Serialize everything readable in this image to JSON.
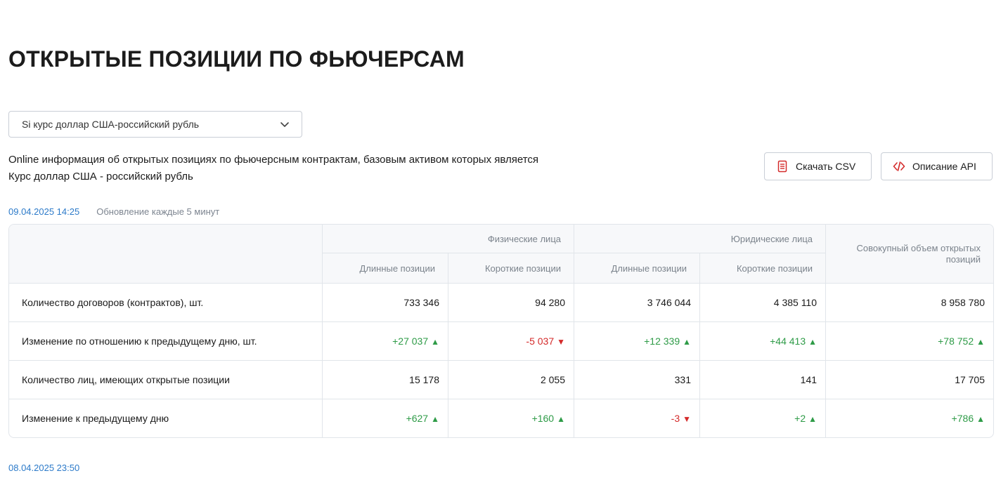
{
  "page": {
    "title": "ОТКРЫТЫЕ ПОЗИЦИИ ПО ФЬЮЧЕРСАМ",
    "selector_value": "Si курс доллар США-российский рубль",
    "description": "Online информация об открытых позициях по фьючерсным контрактам, базовым активом которых является Курс доллар США - российский рубль",
    "buttons": {
      "csv": "Скачать CSV",
      "api": "Описание API"
    },
    "date": "09.04.2025 14:25",
    "update_note": "Обновление каждые 5 минут",
    "next_date": "08.04.2025 23:50"
  },
  "colors": {
    "accent_link": "#2c7ac9",
    "positive": "#2e9b47",
    "negative": "#d42a2a",
    "csv_icon": "#d42a2a",
    "api_icon": "#d42a2a"
  },
  "table": {
    "groups": {
      "individuals": "Физические лица",
      "legal": "Юридические лица",
      "total": "Совокупный объем открытых позиций"
    },
    "subheaders": {
      "long": "Длинные позиции",
      "short": "Короткие позиции"
    },
    "rows": [
      {
        "label": "Количество договоров (контрактов), шт.",
        "cells": [
          {
            "text": "733 346",
            "trend": "none"
          },
          {
            "text": "94 280",
            "trend": "none"
          },
          {
            "text": "3 746 044",
            "trend": "none"
          },
          {
            "text": "4 385 110",
            "trend": "none"
          },
          {
            "text": "8 958 780",
            "trend": "none"
          }
        ]
      },
      {
        "label": "Изменение по отношению к предыдущему дню, шт.",
        "cells": [
          {
            "text": "+27 037",
            "trend": "up"
          },
          {
            "text": "-5 037",
            "trend": "down"
          },
          {
            "text": "+12 339",
            "trend": "up"
          },
          {
            "text": "+44 413",
            "trend": "up"
          },
          {
            "text": "+78 752",
            "trend": "up"
          }
        ]
      },
      {
        "label": "Количество лиц, имеющих открытые позиции",
        "cells": [
          {
            "text": "15 178",
            "trend": "none"
          },
          {
            "text": "2 055",
            "trend": "none"
          },
          {
            "text": "331",
            "trend": "none"
          },
          {
            "text": "141",
            "trend": "none"
          },
          {
            "text": "17 705",
            "trend": "none"
          }
        ]
      },
      {
        "label": "Изменение к предыдущему дню",
        "cells": [
          {
            "text": "+627",
            "trend": "up"
          },
          {
            "text": "+160",
            "trend": "up"
          },
          {
            "text": "-3",
            "trend": "down"
          },
          {
            "text": "+2",
            "trend": "up"
          },
          {
            "text": "+786",
            "trend": "up"
          }
        ]
      }
    ]
  },
  "icons": {
    "selector": "chevron-down-icon",
    "csv": "document-icon",
    "api": "code-icon",
    "up": "triangle-up-icon",
    "down": "triangle-down-icon"
  }
}
